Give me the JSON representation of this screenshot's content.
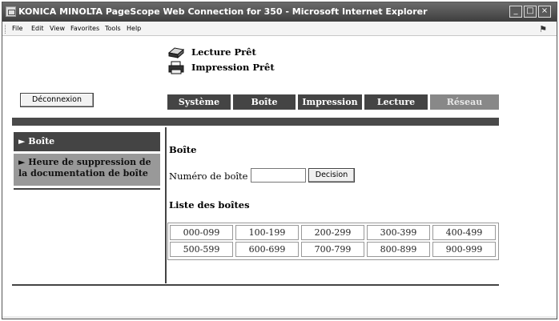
{
  "window": {
    "title": "KONICA MINOLTA PageScope Web Connection for 350 - Microsoft Internet Explorer",
    "controls": [
      "_",
      "□",
      "×"
    ]
  },
  "menubar": {
    "items": [
      "File",
      "Edit",
      "View",
      "Favorites",
      "Tools",
      "Help"
    ]
  },
  "status": {
    "scan": "Lecture Prêt",
    "print": "Impression Prêt"
  },
  "logout_label": "Déconnexion",
  "nav": {
    "tabs": [
      {
        "label": "Système",
        "enabled": true
      },
      {
        "label": "Boîte",
        "enabled": true
      },
      {
        "label": "Impression",
        "enabled": true
      },
      {
        "label": "Lecture",
        "enabled": true
      },
      {
        "label": "Réseau",
        "enabled": false
      }
    ]
  },
  "sidebar": {
    "items": [
      {
        "label": "► Boîte",
        "active": true
      },
      {
        "label": "► Heure de suppression de la documentation de boîte",
        "active": false
      }
    ]
  },
  "content": {
    "title": "Boîte",
    "box_number_label": "Numéro de boîte",
    "box_number_value": "",
    "decision_label": "Decision",
    "list_title": "Liste des boîtes",
    "ranges": [
      [
        "000-099",
        "100-199",
        "200-299",
        "300-399",
        "400-499"
      ],
      [
        "500-599",
        "600-699",
        "700-799",
        "800-899",
        "900-999"
      ]
    ]
  },
  "colors": {
    "titlebar": "#4a4a4a",
    "nav_active": "#444444",
    "nav_disabled": "#888888",
    "sidebar_active": "#444444",
    "sidebar_inactive": "#999999"
  }
}
